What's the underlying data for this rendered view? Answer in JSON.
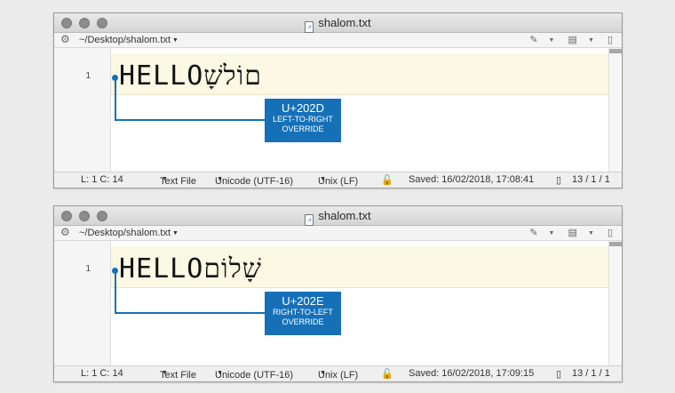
{
  "windows": [
    {
      "title": "shalom.txt",
      "path": "~/Desktop/shalom.txt",
      "line_number": "1",
      "content": "HELLO‭שָׁלוֹם",
      "callout": {
        "codepoint": "U+202D",
        "name_line1": "LEFT-TO-RIGHT",
        "name_line2": "OVERRIDE"
      },
      "status": {
        "position": "L: 1 C: 14",
        "syntax": "Text File",
        "encoding": "Unicode (UTF-16)",
        "line_endings": "Unix (LF)",
        "saved": "Saved: 16/02/2018, 17:08:41",
        "counts": "13 / 1 / 1"
      }
    },
    {
      "title": "shalom.txt",
      "path": "~/Desktop/shalom.txt",
      "line_number": "1",
      "content": "HELLO‮שָׁלוֹם",
      "callout": {
        "codepoint": "U+202E",
        "name_line1": "RIGHT-TO-LEFT",
        "name_line2": "OVERRIDE"
      },
      "status": {
        "position": "L: 1 C: 14",
        "syntax": "Text File",
        "encoding": "Unicode (UTF-16)",
        "line_endings": "Unix (LF)",
        "saved": "Saved: 16/02/2018, 17:09:15",
        "counts": "13 / 1 / 1"
      }
    }
  ],
  "icons": {
    "gear": "gear-icon",
    "pen": "pen-icon",
    "panels": "panels-icon",
    "doc": "document-icon",
    "lock": "lock-icon"
  },
  "colors": {
    "accent": "#1570b8",
    "highlight": "#fbf8e3"
  }
}
